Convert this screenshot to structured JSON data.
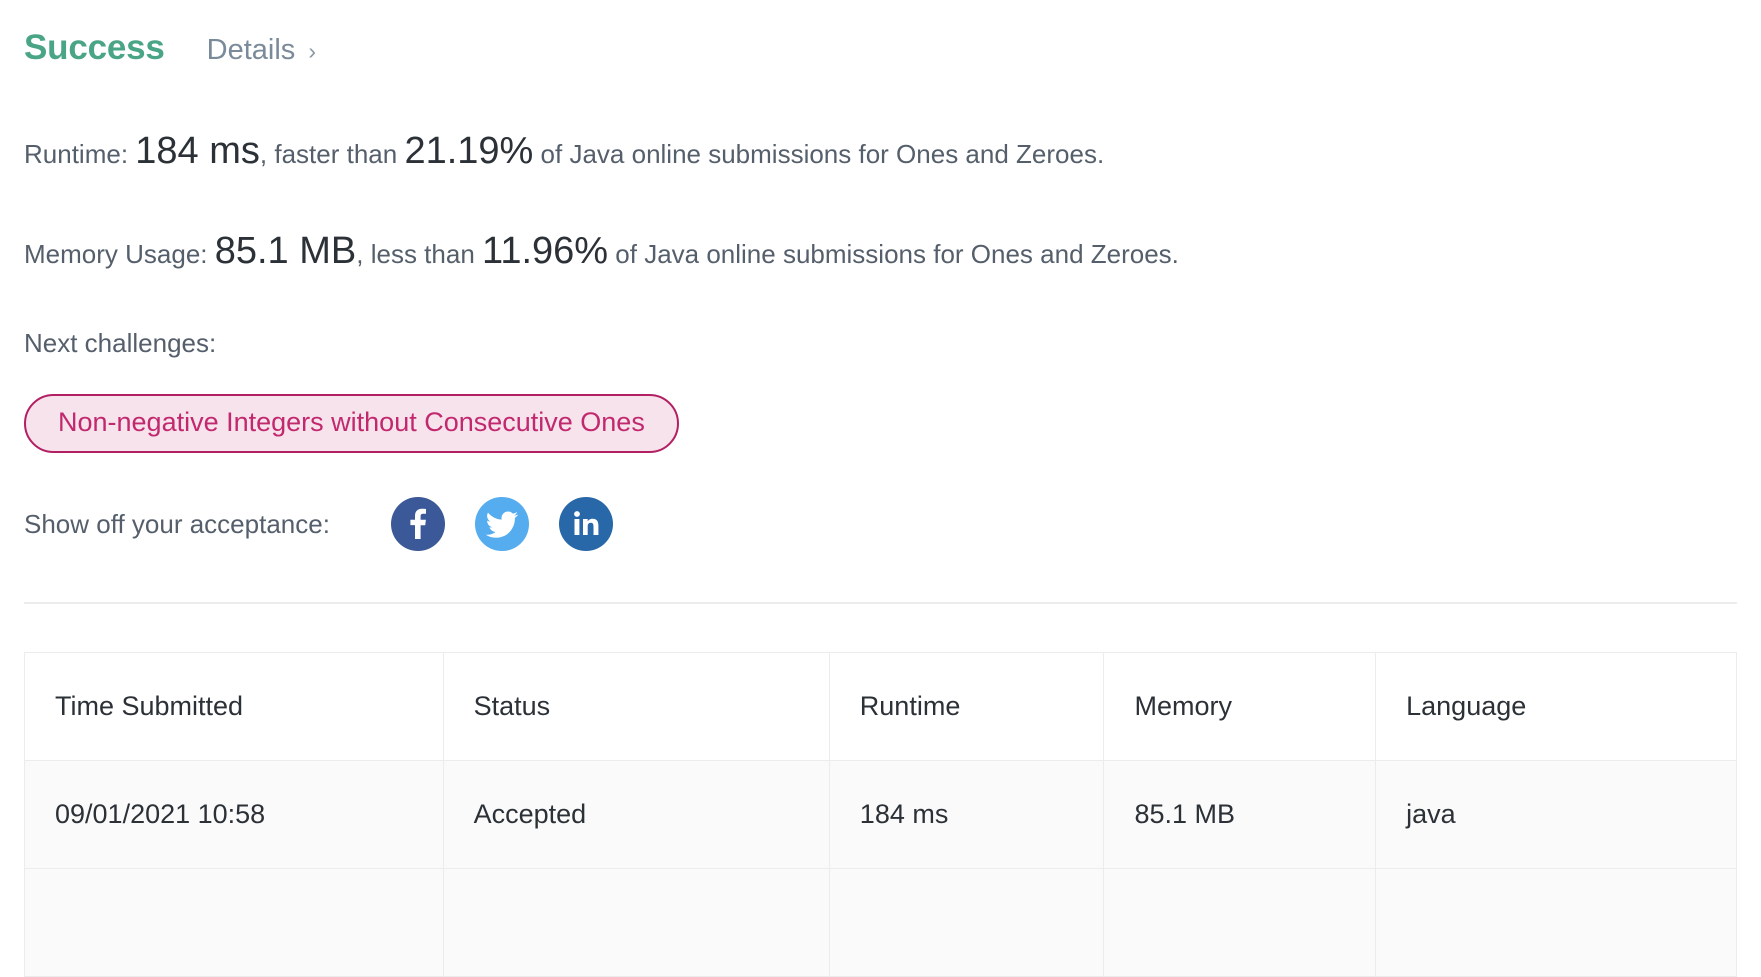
{
  "header": {
    "status_title": "Success",
    "details_label": "Details",
    "details_chevron": "›"
  },
  "results": {
    "runtime": {
      "label": "Runtime:",
      "value": "184 ms",
      "comparator": ", faster than ",
      "percentile": "21.19%",
      "suffix": " of Java online submissions for Ones and Zeroes."
    },
    "memory": {
      "label": "Memory Usage:",
      "value": "85.1 MB",
      "comparator": ", less than ",
      "percentile": "11.96%",
      "suffix": " of Java online submissions for Ones and Zeroes."
    }
  },
  "next_challenges": {
    "label": "Next challenges:",
    "items": [
      {
        "label": "Non-negative Integers without Consecutive Ones"
      }
    ],
    "pill_text_color": "#c2286e",
    "pill_border_color": "#b31f63",
    "pill_background_color": "#f6e3ec"
  },
  "share": {
    "label": "Show off your acceptance:",
    "buttons": [
      {
        "name": "facebook",
        "color": "#3b5998"
      },
      {
        "name": "twitter",
        "color": "#55acee"
      },
      {
        "name": "linkedin",
        "color": "#2867a8"
      }
    ]
  },
  "submissions_table": {
    "columns": [
      "Time Submitted",
      "Status",
      "Runtime",
      "Memory",
      "Language"
    ],
    "rows": [
      {
        "time_submitted": "09/01/2021 10:58",
        "status": "Accepted",
        "runtime": "184 ms",
        "memory": "85.1 MB",
        "language": "java"
      },
      {
        "time_submitted": "",
        "status": "",
        "runtime": "",
        "memory": "",
        "language": ""
      }
    ],
    "accepted_color": "#3f9a7e"
  },
  "colors": {
    "success_green": "#4aa587",
    "body_text": "#555f6b",
    "emphasis_text": "#2b3137"
  }
}
